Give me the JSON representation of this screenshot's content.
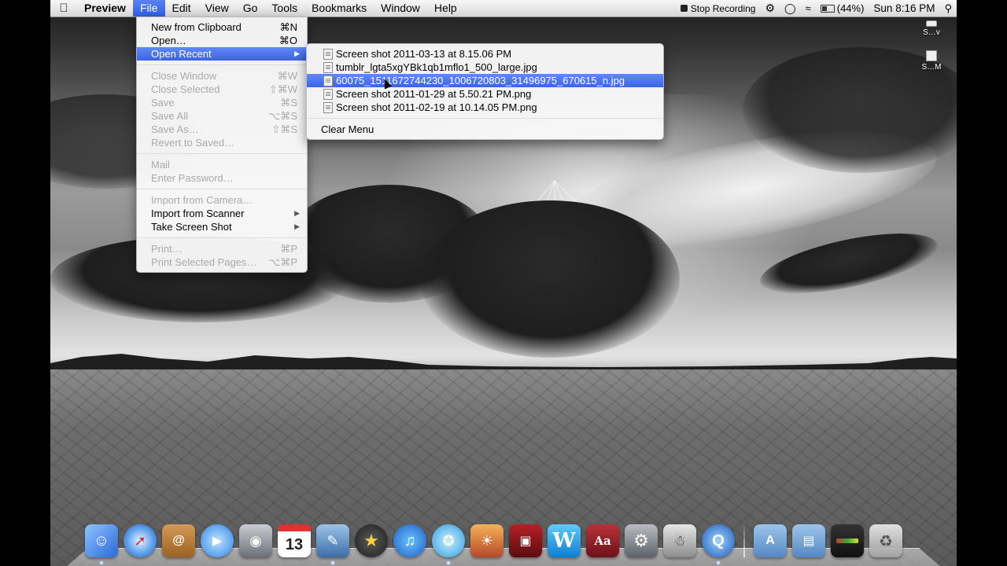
{
  "menubar": {
    "app_name": "Preview",
    "menus": [
      "File",
      "Edit",
      "View",
      "Go",
      "Tools",
      "Bookmarks",
      "Window",
      "Help"
    ],
    "stop_recording": "Stop Recording",
    "battery": "(44%)",
    "clock": "Sun 8:16 PM"
  },
  "file_menu": {
    "new_from_clipboard": "New from Clipboard",
    "new_from_clipboard_sc": "⌘N",
    "open": "Open…",
    "open_sc": "⌘O",
    "open_recent": "Open Recent",
    "close_window": "Close Window",
    "close_window_sc": "⌘W",
    "close_selected": "Close Selected",
    "close_selected_sc": "⇧⌘W",
    "save": "Save",
    "save_sc": "⌘S",
    "save_all": "Save All",
    "save_all_sc": "⌥⌘S",
    "save_as": "Save As…",
    "save_as_sc": "⇧⌘S",
    "revert": "Revert to Saved…",
    "mail": "Mail",
    "enter_password": "Enter Password…",
    "import_camera": "Import from Camera…",
    "import_scanner": "Import from Scanner",
    "take_screenshot": "Take Screen Shot",
    "print": "Print…",
    "print_sc": "⌘P",
    "print_selected": "Print Selected Pages…",
    "print_selected_sc": "⌥⌘P"
  },
  "recent_menu": {
    "items": [
      "Screen shot 2011-03-13 at 8.15.06 PM",
      "tumblr_lgta5xgYBk1qb1mflo1_500_large.jpg",
      "60075_1511672744230_1006720803_31496975_670615_n.jpg",
      "Screen shot 2011-01-29 at 5.50.21 PM.png",
      "Screen shot 2011-02-19 at 10.14.05 PM.png"
    ],
    "clear_menu": "Clear Menu"
  },
  "desktop_icons": [
    {
      "label": "S…v",
      "icon": "disk-icon"
    },
    {
      "label": "S…M",
      "icon": "document-icon"
    }
  ],
  "dock": {
    "calendar_day": "13",
    "dictionary_glyph": "Aa",
    "word_glyph": "W"
  }
}
